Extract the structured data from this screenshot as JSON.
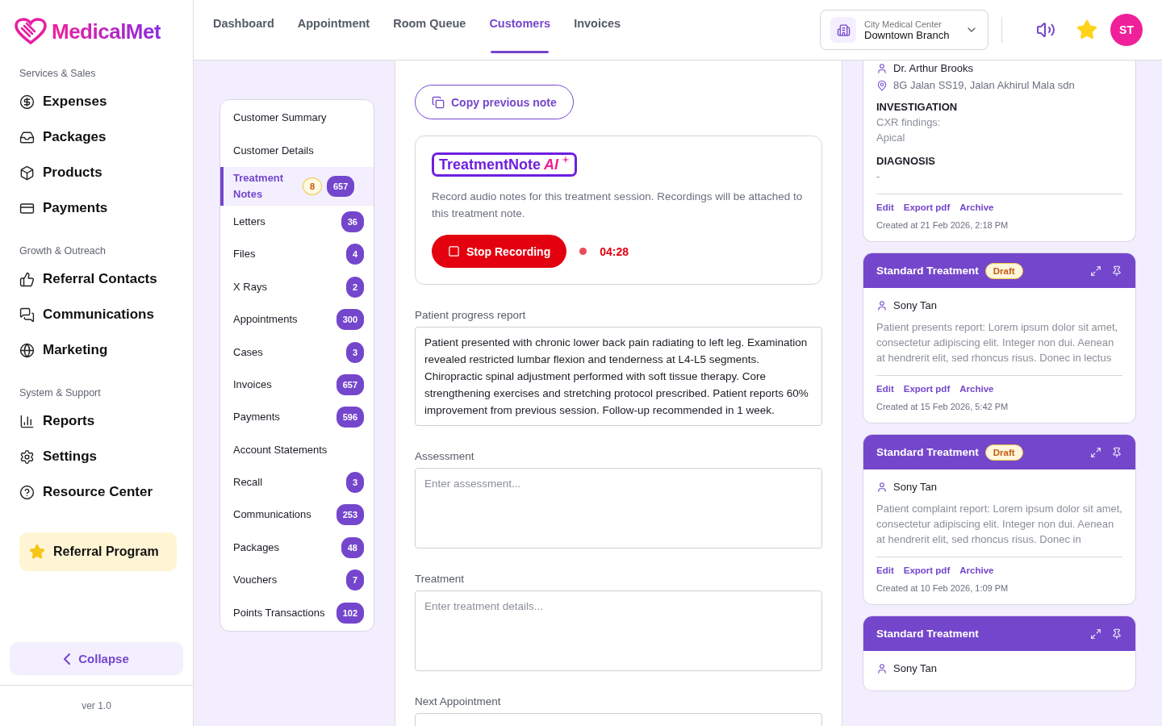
{
  "logo": {
    "text": "MedicalMet"
  },
  "sidebar": {
    "sections": [
      {
        "title": "Services & Sales",
        "items": [
          {
            "label": "Expenses"
          },
          {
            "label": "Packages"
          },
          {
            "label": "Products"
          },
          {
            "label": "Payments"
          }
        ]
      },
      {
        "title": "Growth & Outreach",
        "items": [
          {
            "label": "Referral Contacts"
          },
          {
            "label": "Communications"
          },
          {
            "label": "Marketing"
          }
        ]
      },
      {
        "title": "System & Support",
        "items": [
          {
            "label": "Reports"
          },
          {
            "label": "Settings"
          },
          {
            "label": "Resource Center"
          }
        ]
      }
    ],
    "referral_program": {
      "label": "Referral Program"
    },
    "collapse": {
      "label": "Collapse"
    },
    "version": "ver 1.0"
  },
  "top_nav": {
    "tabs": [
      {
        "label": "Dashboard",
        "selected": false
      },
      {
        "label": "Appointment",
        "selected": false
      },
      {
        "label": "Room Queue",
        "selected": false
      },
      {
        "label": "Customers",
        "selected": true
      },
      {
        "label": "Invoices",
        "selected": false
      }
    ],
    "branch": {
      "organization": "City Medical Center",
      "branch": "Downtown Branch"
    },
    "avatar": "ST"
  },
  "customer_menu": [
    {
      "label": "Customer Summary",
      "selected": false
    },
    {
      "label": "Customer Details",
      "selected": false
    },
    {
      "label": "Treatment Notes",
      "alert": "8",
      "count": "657",
      "selected": true
    },
    {
      "label": "Letters",
      "count": "36",
      "selected": false
    },
    {
      "label": "Files",
      "count": "4",
      "selected": false
    },
    {
      "label": "X Rays",
      "count": "2",
      "selected": false
    },
    {
      "label": "Appointments",
      "count": "300",
      "selected": false
    },
    {
      "label": "Cases",
      "count": "3",
      "selected": false
    },
    {
      "label": "Invoices",
      "count": "657",
      "selected": false
    },
    {
      "label": "Payments",
      "count": "596",
      "selected": false
    },
    {
      "label": "Account Statements",
      "selected": false
    },
    {
      "label": "Recall",
      "count": "3",
      "selected": false
    },
    {
      "label": "Communications",
      "count": "253",
      "selected": false
    },
    {
      "label": "Packages",
      "count": "48",
      "selected": false
    },
    {
      "label": "Vouchers",
      "count": "7",
      "selected": false
    },
    {
      "label": "Points Transactions",
      "count": "102",
      "selected": false
    }
  ],
  "editor": {
    "copy_button": "Copy previous note",
    "ai_panel": {
      "brand": "TreatmentNote",
      "brand_suffix": "AI",
      "description": "Record audio notes for this treatment session. Recordings will be attached to this treatment note.",
      "stop_button": "Stop Recording",
      "timer": "04:28"
    },
    "fields": [
      {
        "label": "Patient progress report",
        "value": "Patient presented with chronic lower back pain radiating to left leg. Examination revealed restricted lumbar flexion and tenderness at L4-L5 segments. Chiropractic spinal adjustment performed with soft tissue therapy. Core strengthening exercises and stretching protocol prescribed. Patient reports 60% improvement from previous session. Follow-up recommended in 1 week."
      },
      {
        "label": "Assessment",
        "placeholder": "Enter assessment..."
      },
      {
        "label": "Treatment",
        "placeholder": "Enter treatment details..."
      },
      {
        "label": "Next Appointment"
      }
    ]
  },
  "notes": [
    {
      "person": "Dr. Arthur Brooks",
      "address": "8G Jalan SS19, Jalan Akhirul Mala sdn",
      "sections": [
        {
          "heading": "INVESTIGATION",
          "lines": [
            "CXR findings:",
            "Apical"
          ]
        },
        {
          "heading": "DIAGNOSIS",
          "lines": [
            "-"
          ]
        }
      ],
      "actions": [
        "Edit",
        "Export pdf",
        "Archive"
      ],
      "created": "Created at 21 Feb 2026, 2:18 PM"
    },
    {
      "title": "Standard Treatment",
      "status": "Draft",
      "person": "Sony Tan",
      "body": "Patient presents report: Lorem ipsum dolor sit amet, consectetur adipiscing elit. Integer non dui. Aenean at hendrerit elit, sed rhoncus risus. Donec in lectus",
      "actions": [
        "Edit",
        "Export pdf",
        "Archive"
      ],
      "created": "Created at 15 Feb 2026, 5:42 PM"
    },
    {
      "title": "Standard Treatment",
      "status": "Draft",
      "person": "Sony Tan",
      "body": "Patient complaint report: Lorem ipsum dolor sit amet, consectetur adipiscing elit. Integer non dui. Aenean at hendrerit elit, sed rhoncus risus. Donec in",
      "actions": [
        "Edit",
        "Export pdf",
        "Archive"
      ],
      "created": "Created at 10 Feb 2026, 1:09 PM"
    },
    {
      "title": "Standard Treatment",
      "person": "Sony Tan"
    }
  ]
}
